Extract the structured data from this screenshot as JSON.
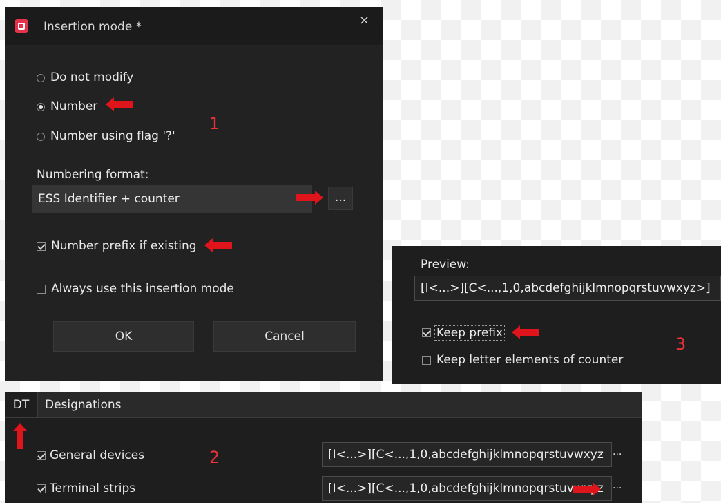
{
  "dialog": {
    "title": "Insertion mode *",
    "close": "×",
    "radio_options": [
      {
        "label": "Do not modify",
        "selected": false
      },
      {
        "label": "Number",
        "selected": true
      },
      {
        "label": "Number using flag '?'",
        "selected": false
      }
    ],
    "numbering_format_label": "Numbering format:",
    "numbering_format_value": "ESS Identifier + counter",
    "browse_button": "...",
    "number_prefix_label": "Number prefix if existing",
    "number_prefix_checked": true,
    "always_use_label": "Always use this insertion mode",
    "always_use_checked": false,
    "ok_label": "OK",
    "cancel_label": "Cancel"
  },
  "preview_panel": {
    "label": "Preview:",
    "value": "[I<...>][C<...,1,0,abcdefghijklmnopqrstuvwxyz>]",
    "keep_prefix_label": "Keep prefix",
    "keep_prefix_checked": true,
    "keep_letter_label": "Keep letter elements of counter",
    "keep_letter_checked": false
  },
  "designations_panel": {
    "tabs": [
      "DT",
      "Designations"
    ],
    "rows": [
      {
        "label": "General devices",
        "checked": true,
        "value": "[I<...>][C<...,1,0,abcdefghijklmnopqrstuvwxyz",
        "button": "..."
      },
      {
        "label": "Terminal strips",
        "checked": true,
        "value": "[I<...>][C<...,1,0,abcdefghijklmnopqrstuvwxyz",
        "button": "..."
      }
    ]
  },
  "annotations": {
    "step1": "1",
    "step2": "2",
    "step3": "3",
    "arrow_color": "#e0141b"
  }
}
